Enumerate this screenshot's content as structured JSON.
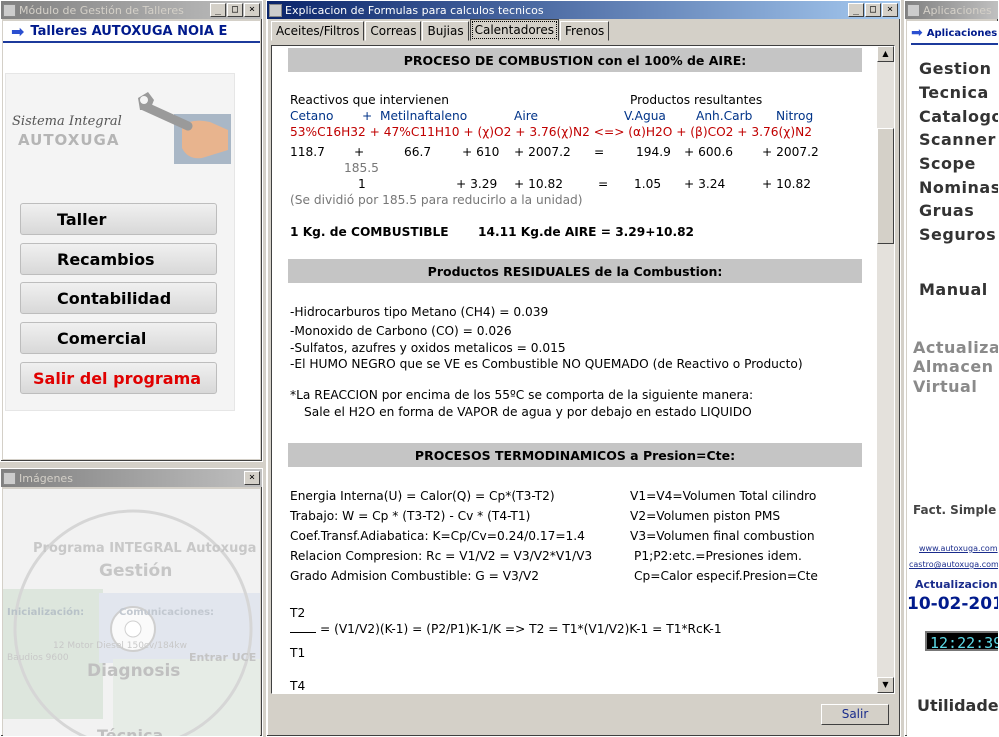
{
  "windows": {
    "modulo": {
      "title": "Módulo de Gestión de Talleres",
      "header": "Talleres AUTOXUGA NOIA E",
      "logo_line1": "Sistema Integral",
      "logo_line2": "AUTOXUGA",
      "buttons": [
        "Taller",
        "Recambios",
        "Contabilidad",
        "Comercial",
        "Salir del programa"
      ],
      "exit_color": "#e00000"
    },
    "imagenes": {
      "title": "Imágenes",
      "text_line1": "Programa INTEGRAL Autoxuga",
      "text_gestion": "Gestión",
      "text_diagnosis": "Diagnosis",
      "text_tecnica": "Técnica",
      "text_entrar": "Entrar UCE",
      "text_inicializacion": "Inicialización:",
      "text_comunicaciones": "Comunicaciones:",
      "text_motor": "12 Motor Diesel 150cv/184kw",
      "text_baudios": "Baudios 9600"
    },
    "main": {
      "title": "Explicacion de Formulas para calculos tecnicos",
      "tabs": [
        "Aceites/Filtros",
        "Correas",
        "Bujias",
        "Calentadores",
        "Frenos"
      ],
      "selected_tab": "Calentadores",
      "salir_label": "Salir"
    },
    "apps": {
      "title": "Aplicaciones",
      "header": "Aplicaciones",
      "items": [
        "Gestion",
        "Tecnica",
        "Catalogo",
        "Scanner",
        "Scope",
        "Nominas",
        "Gruas",
        "Seguros"
      ],
      "manual": "Manual",
      "actualizar": [
        "Actualizar",
        "Almacen",
        "Virtual"
      ],
      "fact": "Fact. Simple",
      "web": "www.autoxuga.com",
      "email": "castro@autoxuga.com",
      "actualizacion_label": "Actualizacion",
      "date": "10-02-201",
      "clock": "12:22:39",
      "utilidades": "Utilidades"
    }
  },
  "doc": {
    "h1": "PROCESO DE COMBUSTION con el 100% de AIRE:",
    "r1": {
      "a": "Reactivos que intervienen",
      "b": "Productos resultantes"
    },
    "r2": {
      "a": "Cetano",
      "b": "+",
      "c": "Metilnaftaleno",
      "d": "Aire",
      "e": "V.Agua",
      "f": "Anh.Carb",
      "g": "Nitrog"
    },
    "r3": "53%C16H32 + 47%C11H10 + (χ)O2 + 3.76(χ)N2 <=> (α)H2O + (β)CO2 + 3.76(χ)N2",
    "r4": [
      "118.7",
      "+",
      "66.7",
      "+ 610",
      "+ 2007.2",
      "=",
      "194.9",
      "+ 600.6",
      "+ 2007.2"
    ],
    "r5": "185.5",
    "r6": [
      "1",
      "+ 3.29",
      "+ 10.82",
      "=",
      "1.05",
      "+ 3.24",
      "+ 10.82"
    ],
    "r7": "(Se dividió por 185.5 para reducirlo a la unidad)",
    "r8": {
      "a": "1 Kg. de COMBUSTIBLE",
      "b": "14.11 Kg.de AIRE = 3.29+10.82"
    },
    "h2": "Productos RESIDUALES de la Combustion:",
    "res": [
      "-Hidrocarburos tipo Metano (CH4) = 0.039",
      "-Monoxido de Carbono (CO) = 0.026",
      "-Sulfatos, azufres y oxidos metalicos = 0.015",
      "-El HUMO NEGRO que se VE es Combustible NO QUEMADO (de Reactivo o Producto)"
    ],
    "reac1": "*La REACCION por encima de los 55ºC se comporta de la siguiente manera:",
    "reac2": "Sale el H2O en forma de VAPOR de agua y por debajo en estado LIQUIDO",
    "h3": "PROCESOS TERMODINAMICOS a Presion=Cte:",
    "thermo_left": [
      "Energia Interna(U) = Calor(Q) = Cp*(T3-T2)",
      "Trabajo: W = Cp * (T3-T2) - Cv * (T4-T1)",
      "Coef.Transf.Adiabatica: K=Cp/Cv=0.24/0.17=1.4",
      "Relacion Compresion: Rc = V1/V2 = V3/V2*V1/V3",
      "Grado Admision Combustible: G = V3/V2"
    ],
    "thermo_right": [
      "V1=V4=Volumen Total cilindro",
      "V2=Volumen piston PMS",
      "V3=Volumen final combustion",
      "P1;P2:etc.=Presiones idem.",
      "Cp=Calor especif.Presion=Cte"
    ],
    "frac_top": "T2",
    "frac_bot": "T1",
    "formula": "= (V1/V2)(K-1) = (P2/P1)K-1/K => T2 = T1*(V1/V2)K-1 = T1*RcK-1",
    "last": "T4"
  }
}
